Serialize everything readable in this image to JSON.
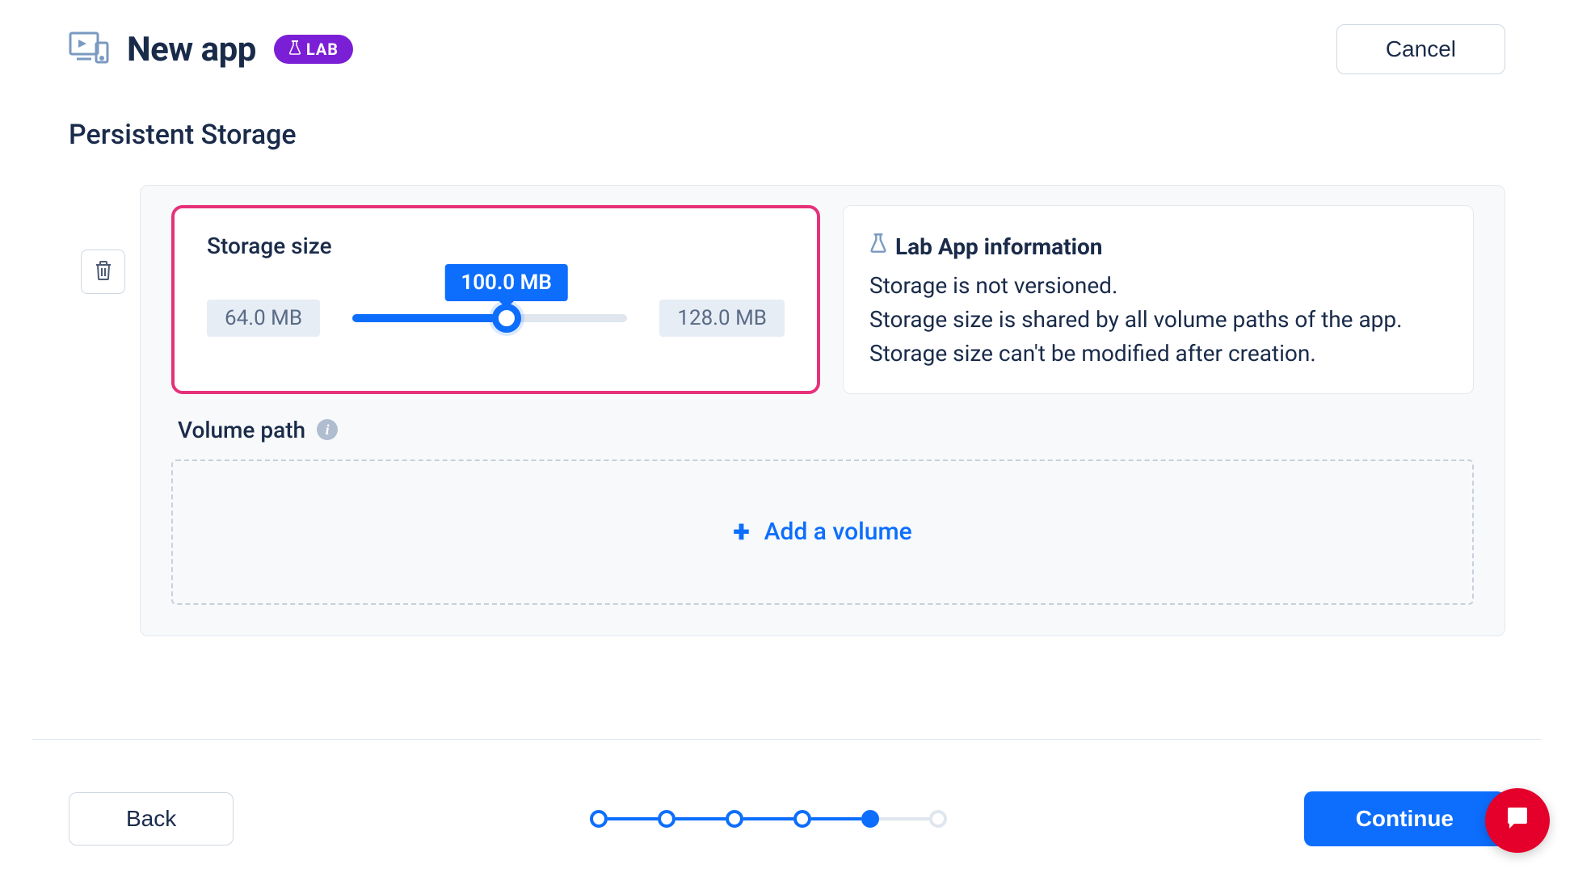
{
  "header": {
    "title": "New app",
    "badge_label": "LAB",
    "cancel_label": "Cancel"
  },
  "section": {
    "title": "Persistent Storage"
  },
  "storage": {
    "label": "Storage size",
    "min_label": "64.0 MB",
    "max_label": "128.0 MB",
    "current_label": "100.0 MB",
    "min": 64.0,
    "max": 128.0,
    "current": 100.0,
    "unit": "MB"
  },
  "info": {
    "title": "Lab App information",
    "line1": "Storage is not versioned.",
    "line2": "Storage size is shared by all volume paths of the app.",
    "line3": "Storage size can't be modified after creation."
  },
  "volume": {
    "label": "Volume path",
    "add_label": "Add a volume"
  },
  "footer": {
    "back_label": "Back",
    "continue_label": "Continue",
    "total_steps": 6,
    "completed_steps": 4,
    "current_step": 5
  },
  "colors": {
    "accent": "#0d6efd",
    "highlight_border": "#e6317a",
    "badge_bg": "#7b1fd6",
    "chat_bg": "#e4002b"
  }
}
